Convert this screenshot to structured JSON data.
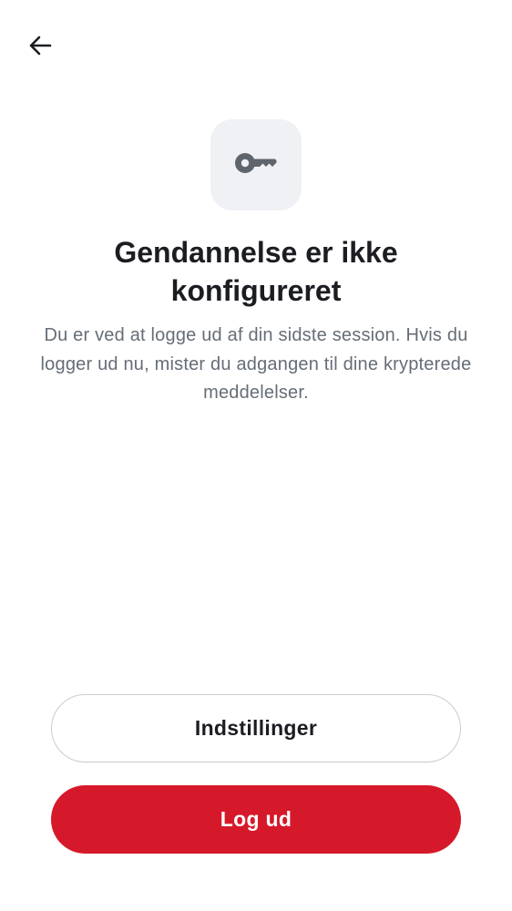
{
  "header": {
    "back_icon": "arrow-left-icon"
  },
  "hero": {
    "icon": "key-icon",
    "icon_tile_color": "#f0f1f5",
    "icon_color": "#5f656d"
  },
  "content": {
    "title": "Gendannelse er ikke\nkonfigureret",
    "description": "Du er ved at logge ud af din sidste session. Hvis du logger ud nu, mister du adgangen til dine krypterede meddelelser."
  },
  "actions": {
    "settings_label": "Indstillinger",
    "logout_label": "Log ud",
    "logout_color": "#d6192a"
  }
}
